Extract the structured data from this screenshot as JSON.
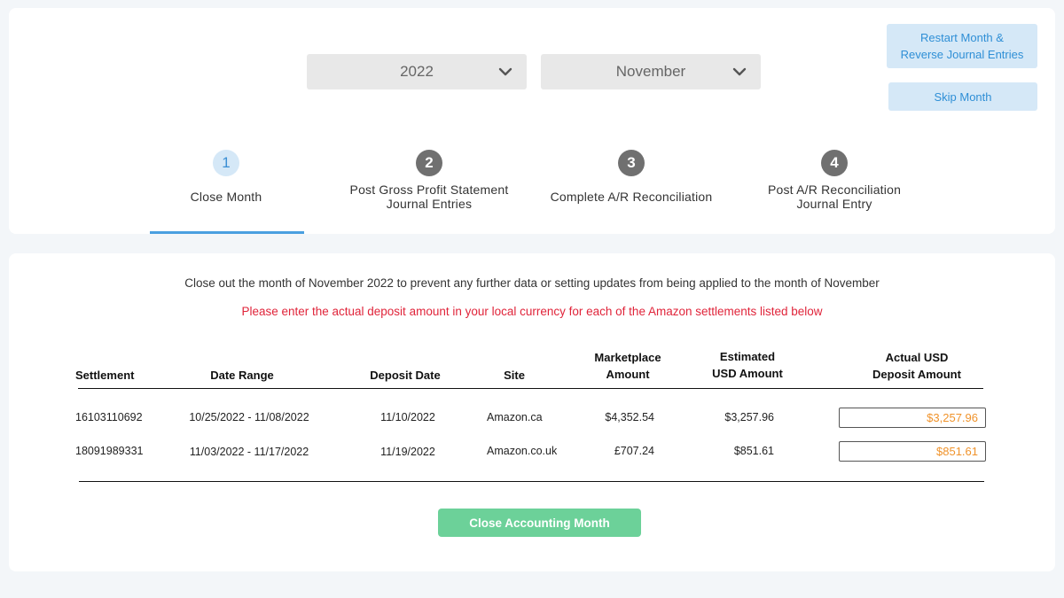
{
  "header": {
    "year_select": {
      "value": "2022",
      "icon": "chevron-down-icon"
    },
    "month_select": {
      "value": "November",
      "icon": "chevron-down-icon"
    },
    "restart_button": {
      "line1": "Restart Month &",
      "line2": "Reverse Journal Entries"
    },
    "skip_button": "Skip Month"
  },
  "steps": [
    {
      "number": "1",
      "line1": "Close Month",
      "line2": ""
    },
    {
      "number": "2",
      "line1": "Post Gross Profit Statement",
      "line2": "Journal Entries"
    },
    {
      "number": "3",
      "line1": "Complete A/R Reconciliation",
      "line2": ""
    },
    {
      "number": "4",
      "line1": "Post A/R Reconciliation",
      "line2": "Journal Entry"
    }
  ],
  "main": {
    "intro": "Close out the month of November 2022 to prevent any further data or setting updates from being applied to the month of November",
    "warning": "Please enter the actual deposit amount in your local currency for each of the Amazon settlements listed below",
    "table": {
      "headers": {
        "settlement": "Settlement",
        "date_range": "Date Range",
        "deposit_date": "Deposit Date",
        "site": "Site",
        "marketplace_amount": {
          "line1": "Marketplace",
          "line2": "Amount"
        },
        "estimated_usd": {
          "line1": "Estimated",
          "line2": "USD Amount"
        },
        "actual_usd": {
          "line1": "Actual USD",
          "line2": "Deposit Amount"
        }
      },
      "rows": [
        {
          "settlement": "16103110692",
          "date_range": "10/25/2022 - 11/08/2022",
          "deposit_date": "11/10/2022",
          "site": "Amazon.ca",
          "marketplace_amount": "$4,352.54",
          "estimated_usd": "$3,257.96",
          "actual_usd": "$3,257.96"
        },
        {
          "settlement": "18091989331",
          "date_range": "11/03/2022 - 11/17/2022",
          "deposit_date": "11/19/2022",
          "site": "Amazon.co.uk",
          "marketplace_amount": "£707.24",
          "estimated_usd": "$851.61",
          "actual_usd": "$851.61"
        }
      ]
    },
    "close_button": "Close Accounting Month"
  },
  "colors": {
    "accent_blue": "#4a9fe0",
    "warning_red": "#e0243a",
    "input_orange": "#f0932b",
    "close_green": "#6cd199"
  }
}
